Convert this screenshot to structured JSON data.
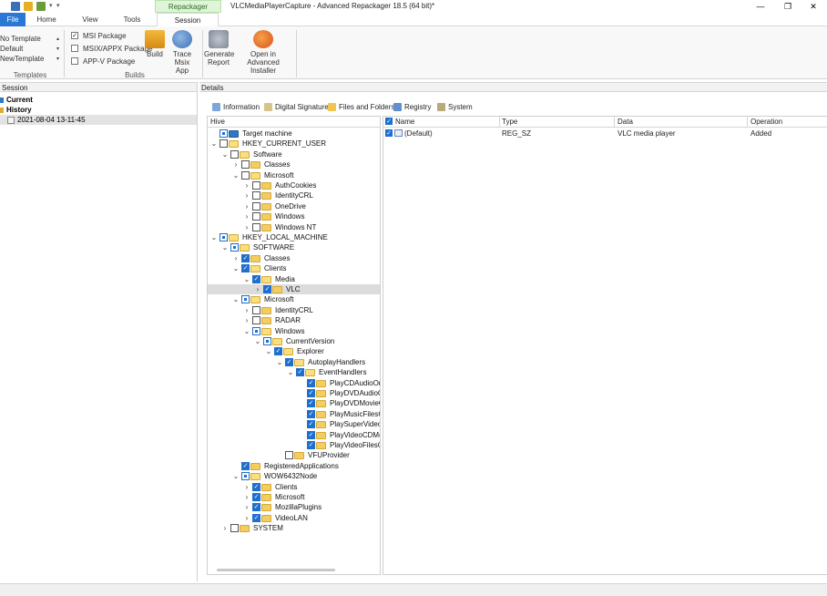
{
  "window": {
    "title": "VLCMediaPlayerCapture - Advanced Repackager 18.5 (64 bit)*",
    "context_tab": "Repackager Session",
    "minimize_glyph": "—",
    "maximize_glyph": "❐",
    "close_glyph": "✕"
  },
  "tabs": {
    "file": "File",
    "home": "Home",
    "view": "View",
    "tools": "Tools",
    "session": "Session"
  },
  "ribbon": {
    "templates": {
      "items": [
        "No Template",
        "Default",
        "NewTemplate"
      ],
      "group_label": "Templates"
    },
    "builds": {
      "msi_label": "MSI Package",
      "msix_label": "MSIX/APPX Package",
      "appv_label": "APP-V Package",
      "build_label": "Build",
      "trace_label_1": "Trace",
      "trace_label_2": "Msix App",
      "group_label": "Builds"
    },
    "report": {
      "generate_1": "Generate",
      "generate_2": "Report",
      "open_1": "Open in Advanced",
      "open_2": "Installer"
    }
  },
  "left_pane": {
    "header": "Session",
    "current": "Current",
    "history": "History",
    "history_item": "2021-08-04 13-11-45"
  },
  "details": {
    "header": "Details",
    "tabs": [
      "Information",
      "Digital Signature",
      "Files and Folders",
      "Registry",
      "System"
    ]
  },
  "tree": {
    "header": "Hive",
    "nodes": [
      {
        "label": "Target machine"
      },
      {
        "label": "HKEY_CURRENT_USER"
      },
      {
        "label": "Software"
      },
      {
        "label": "Classes"
      },
      {
        "label": "Microsoft"
      },
      {
        "label": "AuthCookies"
      },
      {
        "label": "IdentityCRL"
      },
      {
        "label": "OneDrive"
      },
      {
        "label": "Windows"
      },
      {
        "label": "Windows NT"
      },
      {
        "label": "HKEY_LOCAL_MACHINE"
      },
      {
        "label": "SOFTWARE"
      },
      {
        "label": "Classes"
      },
      {
        "label": "Clients"
      },
      {
        "label": "Media"
      },
      {
        "label": "VLC"
      },
      {
        "label": "Microsoft"
      },
      {
        "label": "IdentityCRL"
      },
      {
        "label": "RADAR"
      },
      {
        "label": "Windows"
      },
      {
        "label": "CurrentVersion"
      },
      {
        "label": "Explorer"
      },
      {
        "label": "AutoplayHandlers"
      },
      {
        "label": "EventHandlers"
      },
      {
        "label": "PlayCDAudioOnA"
      },
      {
        "label": "PlayDVDAudioOr"
      },
      {
        "label": "PlayDVDMovieOr"
      },
      {
        "label": "PlayMusicFilesOr"
      },
      {
        "label": "PlaySuperVideoC"
      },
      {
        "label": "PlayVideoCDMov"
      },
      {
        "label": "PlayVideoFilesOn"
      },
      {
        "label": "VFUProvider"
      },
      {
        "label": "RegisteredApplications"
      },
      {
        "label": "WOW6432Node"
      },
      {
        "label": "Clients"
      },
      {
        "label": "Microsoft"
      },
      {
        "label": "MozillaPlugins"
      },
      {
        "label": "VideoLAN"
      },
      {
        "label": "SYSTEM"
      }
    ]
  },
  "grid": {
    "columns": [
      "Name",
      "Type",
      "Data",
      "Operation"
    ],
    "rows": [
      {
        "name": "(Default)",
        "type": "REG_SZ",
        "data": "VLC media player",
        "operation": "Added"
      }
    ]
  }
}
